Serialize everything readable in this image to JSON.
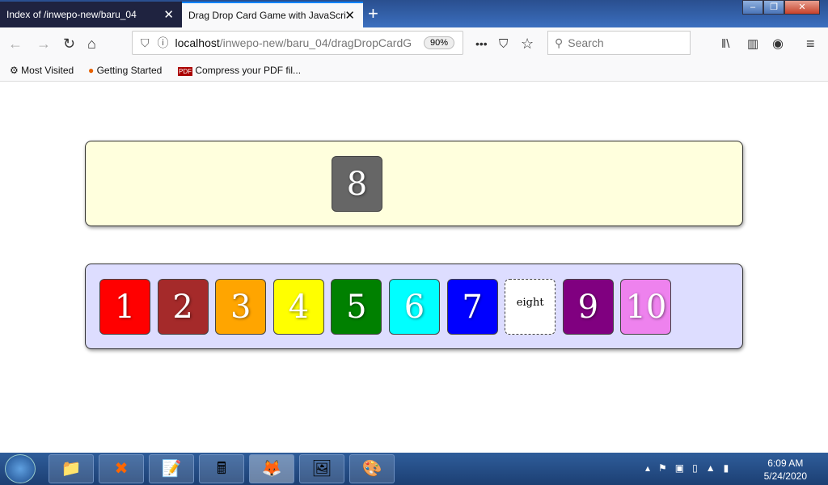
{
  "browser": {
    "tabs": [
      {
        "label": "Index of /inwepo-new/baru_04"
      },
      {
        "label": "Drag Drop Card Game with JavaScri"
      }
    ],
    "url_host": "localhost",
    "url_path": "/inwepo-new/baru_04/dragDropCardG",
    "zoom": "90%",
    "search_placeholder": "Search",
    "bookmarks": [
      "Most Visited",
      "Getting Started",
      "Compress your PDF fil..."
    ]
  },
  "game": {
    "drop_zone_cards": [
      {
        "label": "8",
        "color": "#666666"
      }
    ],
    "hand_cards": [
      {
        "label": "1",
        "color": "#ff0000"
      },
      {
        "label": "2",
        "color": "#a52a2a"
      },
      {
        "label": "3",
        "color": "#ffa500"
      },
      {
        "label": "4",
        "color": "#ffff00"
      },
      {
        "label": "5",
        "color": "#008000"
      },
      {
        "label": "6",
        "color": "#00ffff"
      },
      {
        "label": "7",
        "color": "#0000ff"
      },
      {
        "label": "eight",
        "color": "#ffffff"
      },
      {
        "label": "9",
        "color": "#800080"
      },
      {
        "label": "10",
        "color": "#ee82ee"
      }
    ]
  },
  "taskbar": {
    "time": "6:09 AM",
    "date": "5/24/2020"
  }
}
